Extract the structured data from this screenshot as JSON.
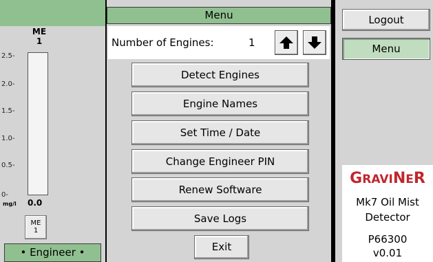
{
  "gauge": {
    "engine_name": "ME",
    "engine_index": "1",
    "ticks": [
      "2.5-",
      "2.0-",
      "1.5-",
      "1.0-",
      "0.5-",
      "0-"
    ],
    "unit": "mg/l",
    "value": "0.0",
    "level_fraction": 0.0,
    "button_name": "ME",
    "button_index": "1"
  },
  "user_role": "• Engineer •",
  "menu": {
    "title": "Menu",
    "engines_label": "Number of Engines:",
    "engines_value": "1",
    "up_icon": "arrow-up-icon",
    "down_icon": "arrow-down-icon",
    "buttons": [
      "Detect Engines",
      "Engine Names",
      "Set Time / Date",
      "Change Engineer PIN",
      "Renew Software",
      "Save Logs"
    ],
    "exit_label": "Exit"
  },
  "nav": {
    "logout_label": "Logout",
    "menu_label": "Menu"
  },
  "info": {
    "brand_first": "G",
    "brand_mid": "RAVI",
    "brand_n": "N",
    "brand_e": "E",
    "brand_r": "R",
    "line1": "Mk7 Oil Mist",
    "line2": "Detector",
    "code": "P66300",
    "version": "v0.01"
  },
  "colors": {
    "header_green": "#90c090",
    "brand_red": "#c0272d",
    "panel_gray": "#d4d4d4"
  }
}
